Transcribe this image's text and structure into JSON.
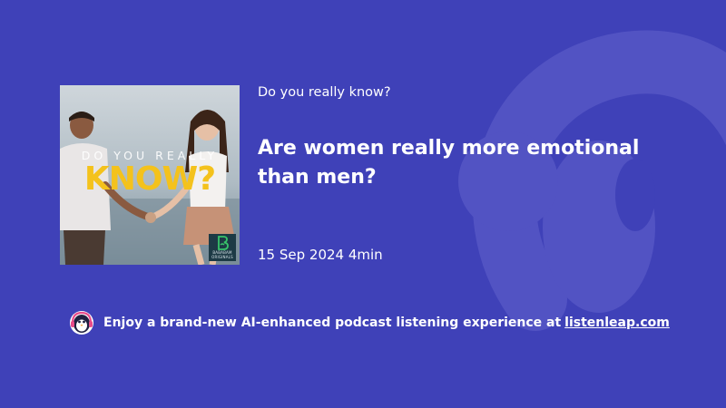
{
  "colors": {
    "background": "#3f41b8",
    "watermark": "#5253c3",
    "cover_title": "#f4c21c"
  },
  "podcast": {
    "name": "Do you really know?",
    "cover": {
      "top_text": "DO YOU REALLY",
      "title_text": "KNOW?",
      "badge_label": "BABABAM ORIGINALS"
    }
  },
  "episode": {
    "title": "Are women really more emotional than men?",
    "date": "15 Sep 2024",
    "duration": "4min"
  },
  "promo": {
    "icon": "penguin-headphones-icon",
    "text": "Enjoy a brand-new AI-enhanced podcast listening experience at",
    "link_text": "listenleap.com"
  },
  "watermark_icon": "headphones-logo-icon"
}
